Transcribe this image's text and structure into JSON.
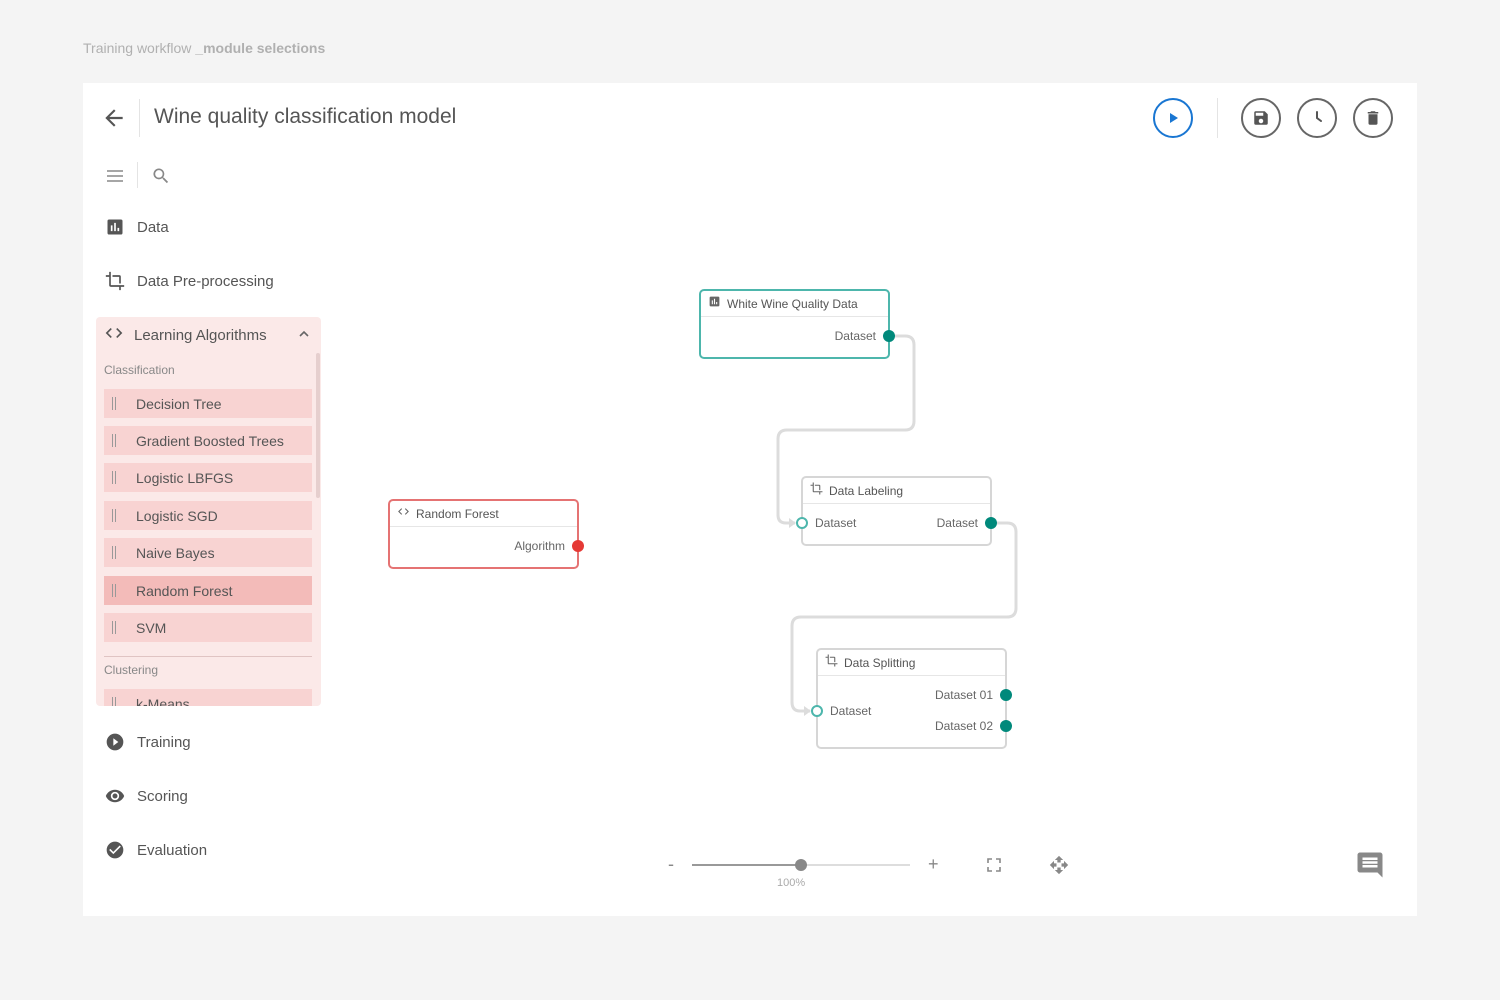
{
  "caption": {
    "prefix": "Training workflow ",
    "bold": "_module selections"
  },
  "header": {
    "title": "Wine quality classification model"
  },
  "toolbar": {
    "back_icon": "arrow-left-icon",
    "run_icon": "play-icon",
    "save_icon": "save-icon",
    "history_icon": "history-icon",
    "delete_icon": "delete-icon",
    "run_color": "#1976d2"
  },
  "sidebar": {
    "menu_icon": "hamburger-icon",
    "search_icon": "search-icon",
    "items": [
      {
        "label": "Data",
        "icon": "bar-chart-icon"
      },
      {
        "label": "Data Pre-processing",
        "icon": "crop-icon"
      },
      {
        "label": "Learning Algorithms",
        "icon": "code-icon",
        "expanded": true
      },
      {
        "label": "Training",
        "icon": "play-circle-icon"
      },
      {
        "label": "Scoring",
        "icon": "eye-icon"
      },
      {
        "label": "Evaluation",
        "icon": "check-circle-icon"
      }
    ],
    "learning": {
      "classification_label": "Classification",
      "classification": [
        "Decision Tree",
        "Gradient Boosted Trees",
        "Logistic LBFGS",
        "Logistic SGD",
        "Naive Bayes",
        "Random Forest",
        "SVM"
      ],
      "active": "Random Forest",
      "clustering_label": "Clustering",
      "clustering": [
        "k-Means"
      ]
    }
  },
  "canvas": {
    "nodes": {
      "white_wine": {
        "title": "White Wine Quality Data",
        "output": "Dataset"
      },
      "random_forest": {
        "title": "Random Forest",
        "output": "Algorithm"
      },
      "labeling": {
        "title": "Data Labeling",
        "input": "Dataset",
        "output": "Dataset"
      },
      "splitting": {
        "title": "Data Splitting",
        "input": "Dataset",
        "output1": "Dataset 01",
        "output2": "Dataset 02"
      }
    },
    "colors": {
      "data": "#4db6ac",
      "algorithm": "#e57373",
      "port": "#00897b",
      "port_algorithm": "#e53935"
    }
  },
  "zoom": {
    "minus": "-",
    "plus": "+",
    "value_label": "100%",
    "level": 0.5
  },
  "tools": {
    "fit_icon": "fullscreen-icon",
    "pan_icon": "move-icon",
    "comment_icon": "comment-icon"
  }
}
